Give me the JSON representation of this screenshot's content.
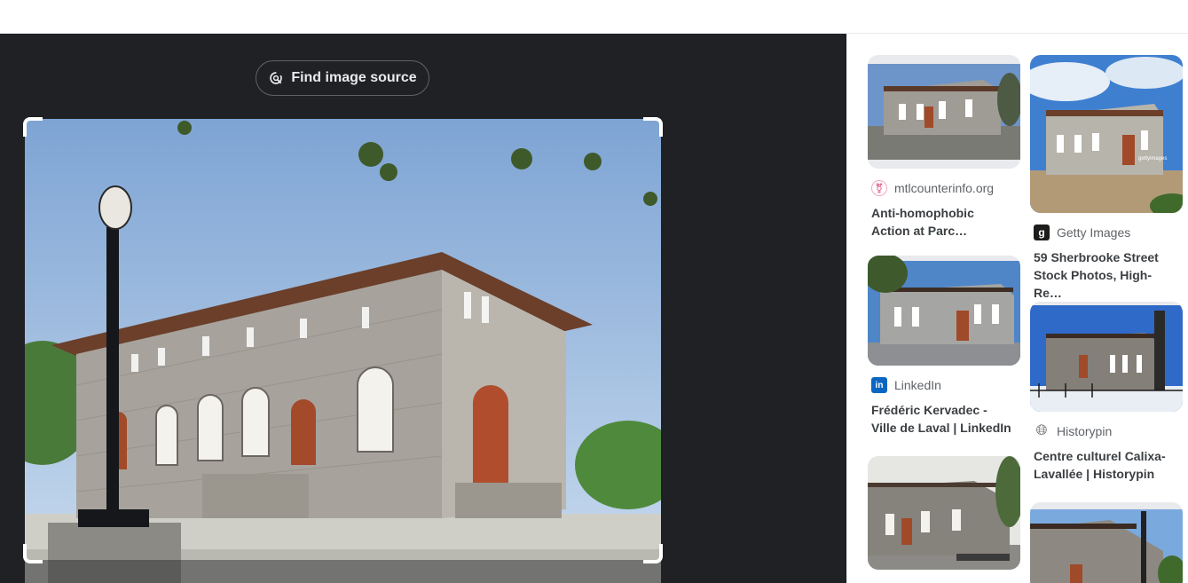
{
  "toolbar": {
    "find_source_label": "Find image source"
  },
  "results": [
    {
      "source": "mtlcounterinfo.org",
      "title_line1": "Anti-homophobic",
      "title_line2": "Action at Parc…"
    },
    {
      "source": "LinkedIn",
      "title_line1": "Frédéric Kervadec -",
      "title_line2": "Ville de Laval | LinkedIn"
    },
    {
      "source": "Getty Images",
      "title_line1": "59 Sherbrooke Street",
      "title_line2": "Stock Photos, High-Re…"
    },
    {
      "source": "Historypin",
      "title_line1": "Centre culturel Calixa-",
      "title_line2": "Lavallée | Historypin"
    }
  ],
  "colors": {
    "dark_bg": "#202124",
    "linkedin": "#0a66c2",
    "text": "#3c4043",
    "muted": "#5f6368"
  }
}
